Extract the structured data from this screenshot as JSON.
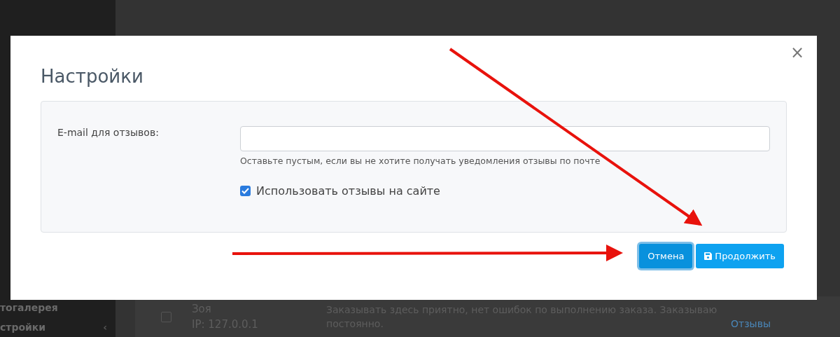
{
  "sidebar": {
    "items": [
      {
        "label": "тогалерея"
      },
      {
        "label": "стройки",
        "caret": "‹"
      }
    ]
  },
  "review": {
    "checked": false,
    "author": "Зоя",
    "ip": "IP: 127.0.0.1",
    "text": "Заказывать здесь приятно, нет ошибок по выполнению заказа. Заказываю постоянно.",
    "link": "Отзывы"
  },
  "modal": {
    "title": "Настройки",
    "close": "×",
    "email": {
      "label": "E-mail для отзывов:",
      "help": "Оставьте пустым, если вы не хотите получать уведомления отзывы по почте"
    },
    "checkbox": {
      "label": "Использовать отзывы на сайте",
      "checked": true
    },
    "buttons": [
      {
        "label": "Отмена",
        "kind": "cancel",
        "focused": true
      },
      {
        "label": "Продолжить",
        "kind": "save",
        "focused": false
      }
    ]
  }
}
